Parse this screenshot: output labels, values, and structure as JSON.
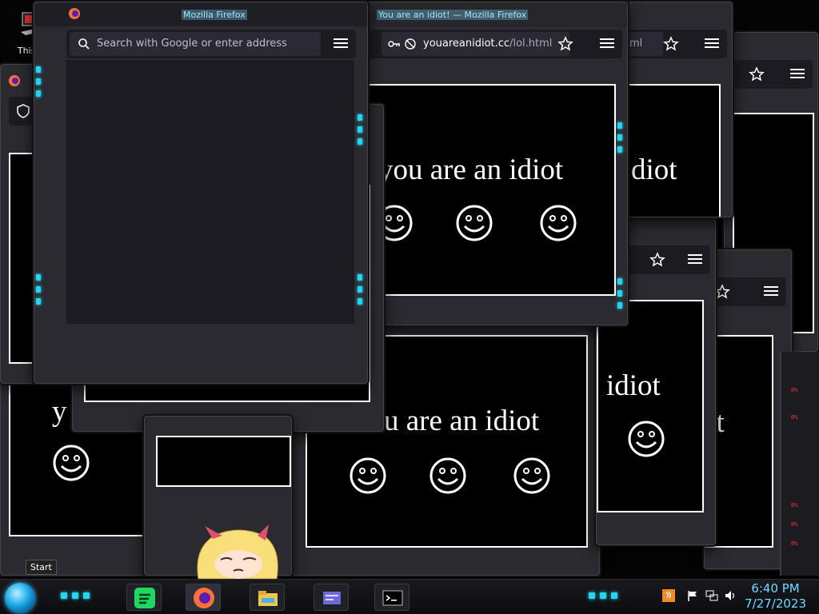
{
  "desktop_icon": {
    "label": "This PC"
  },
  "windows": {
    "front": {
      "title": "Mozilla Firefox",
      "url_placeholder": "Search with Google or enter address"
    },
    "idiot": {
      "title": "You are an idiot! — Mozilla Firefox",
      "url_host": "youareanidiot.cc",
      "url_path": "/lol.html",
      "url_tail": "ml"
    },
    "text": {
      "phrase": "you are an idiot",
      "partial_diot": "diot",
      "partial_idiot": "idiot",
      "partial_u": "u are an idiot",
      "partial_y": "y",
      "partial_ot": "ot"
    }
  },
  "taskbar": {
    "start_tooltip": "Start",
    "apps": [
      "spotify-icon",
      "firefox-icon",
      "file-explorer-icon",
      "control-panel-icon",
      "cmd-icon"
    ],
    "clock_time": "6:40 PM",
    "clock_date": "7/27/2023",
    "tray_icons": [
      "java-icon",
      "flag-icon",
      "network-icon",
      "volume-icon"
    ]
  },
  "side_widget": {
    "readings": [
      "0%",
      "0%",
      "0%",
      "0%",
      "0%"
    ]
  },
  "colors": {
    "accent": "#24d4ee",
    "clock": "#6fd9ff",
    "chrome": "#2a2a30"
  }
}
